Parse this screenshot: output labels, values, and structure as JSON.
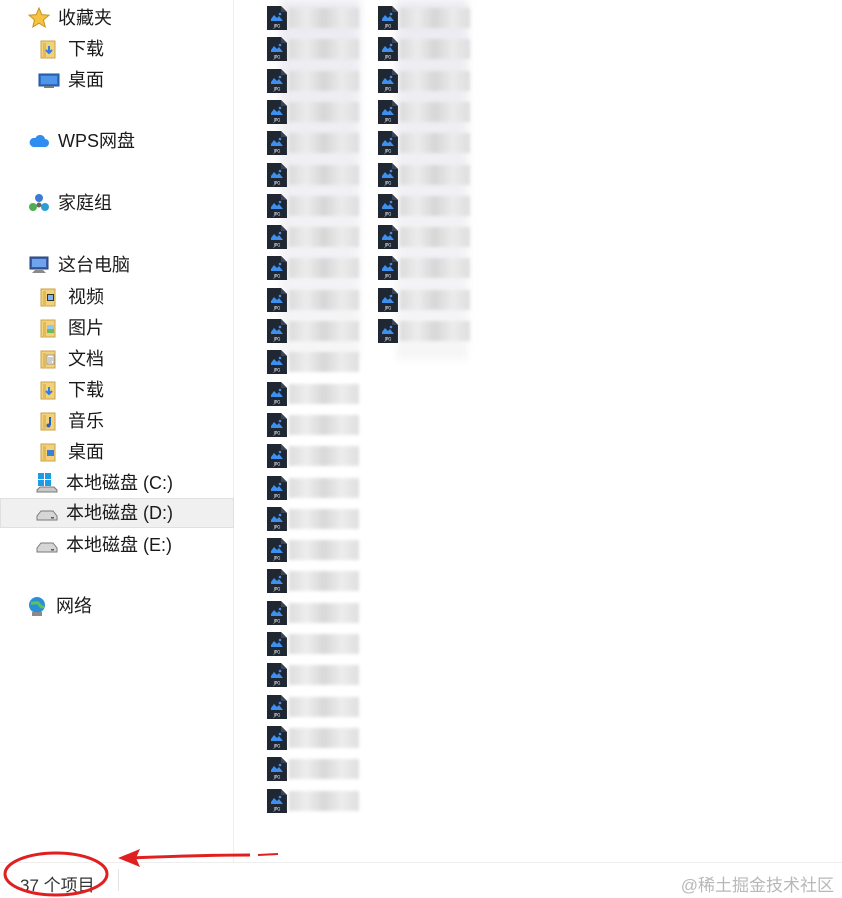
{
  "nav": {
    "favorites": {
      "label": "收藏夹",
      "icon": "star-icon"
    },
    "favorites_items": [
      {
        "label": "下载",
        "icon": "downloads-folder-icon"
      },
      {
        "label": "桌面",
        "icon": "desktop-icon"
      }
    ],
    "wps": {
      "label": "WPS网盘",
      "icon": "cloud-icon"
    },
    "homegroup": {
      "label": "家庭组",
      "icon": "homegroup-icon"
    },
    "thispc": {
      "label": "这台电脑",
      "icon": "computer-icon"
    },
    "thispc_items": [
      {
        "label": "视频",
        "icon": "videos-folder-icon"
      },
      {
        "label": "图片",
        "icon": "pictures-folder-icon"
      },
      {
        "label": "文档",
        "icon": "documents-folder-icon"
      },
      {
        "label": "下载",
        "icon": "downloads-folder-icon"
      },
      {
        "label": "音乐",
        "icon": "music-folder-icon"
      },
      {
        "label": "桌面",
        "icon": "desktop-folder-icon"
      },
      {
        "label": "本地磁盘 (C:)",
        "icon": "windows-drive-icon"
      },
      {
        "label": "本地磁盘 (D:)",
        "icon": "drive-icon",
        "selected": true
      },
      {
        "label": "本地磁盘 (E:)",
        "icon": "drive-icon"
      }
    ],
    "network": {
      "label": "网络",
      "icon": "network-icon"
    }
  },
  "files": {
    "column1_count": 26,
    "column2_count": 11,
    "file_type_badge": "JPG"
  },
  "status": {
    "item_count": "37 个项目"
  },
  "watermark": "@稀土掘金技术社区",
  "colors": {
    "annotation_red": "#e02020",
    "jpg_icon_dark": "#1f2733",
    "jpg_icon_blue": "#3d8ff0"
  }
}
